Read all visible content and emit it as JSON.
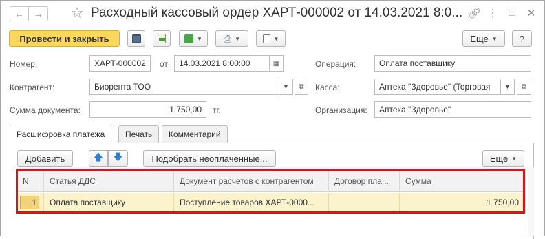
{
  "window": {
    "title": "Расходный кассовый ордер ХАРТ-000002 от 14.03.2021 8:0..."
  },
  "toolbar": {
    "post_close": "Провести и закрыть",
    "more": "Еще",
    "help": "?"
  },
  "form": {
    "number": {
      "label": "Номер:",
      "value": "ХАРТ-000002"
    },
    "date": {
      "label": "от:",
      "value": "14.03.2021  8:00:00"
    },
    "operation": {
      "label": "Операция:",
      "value": "Оплата поставщику"
    },
    "counterparty": {
      "label": "Контрагент:",
      "value": "Биорента ТОО"
    },
    "cashbox": {
      "label": "Касса:",
      "value": "Аптека \"Здоровье\" (Торговая"
    },
    "amount": {
      "label": "Сумма документа:",
      "value": "1 750,00",
      "currency": "тг."
    },
    "organization": {
      "label": "Организация:",
      "value": "Аптека \"Здоровье\""
    }
  },
  "tabs": [
    {
      "label": "Расшифровка платежа",
      "active": true
    },
    {
      "label": "Печать",
      "active": false
    },
    {
      "label": "Комментарий",
      "active": false
    }
  ],
  "table_toolbar": {
    "add": "Добавить",
    "pick_unpaid": "Подобрать неоплаченные...",
    "more": "Еще"
  },
  "table": {
    "columns": [
      "N",
      "Статья ДДС",
      "Документ расчетов с контрагентом",
      "Договор пла...",
      "Сумма"
    ],
    "rows": [
      [
        "1",
        "Оплата поставщику",
        "Поступление товаров ХАРТ-0000...",
        "",
        "1 750,00"
      ]
    ]
  },
  "colors": {
    "primary_button": "#fbd75b",
    "selected_row": "#fbf3cc",
    "highlight_box": "#e0101a"
  }
}
